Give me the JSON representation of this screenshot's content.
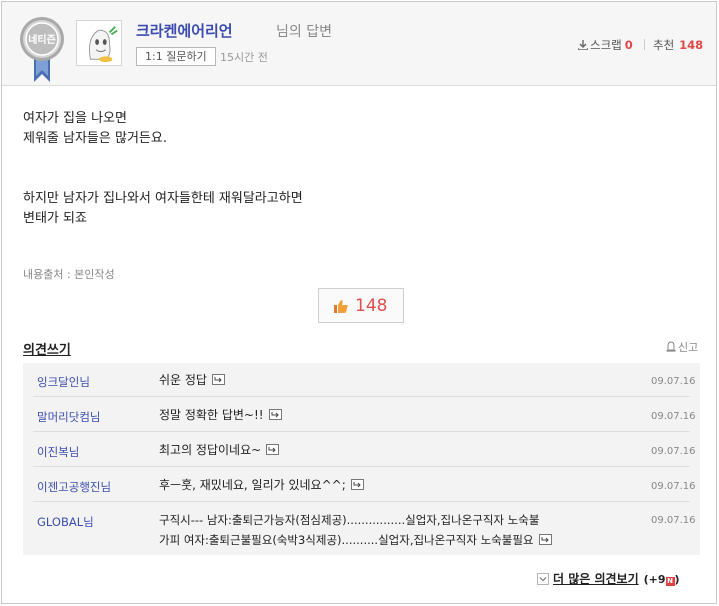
{
  "header": {
    "badge_text": "네티즌",
    "author_name": "크라켄에어리언",
    "author_suffix": "님의 답변",
    "qna_button": "1:1 질문하기",
    "time_ago": "15시간 전",
    "scrap_label": "스크랩",
    "scrap_count": "0",
    "recommend_label": "추천",
    "recommend_count": "148"
  },
  "answer": {
    "lines": [
      "여자가 집을 나오면",
      "제워줄 남자들은 많거든요.",
      "하지만 남자가 집나와서 여자들한테 재워달라고하면",
      "변태가 되죠"
    ],
    "source": "내용출처 : 본인작성"
  },
  "like_button": {
    "count": "148"
  },
  "opinion": {
    "title": "의견쓰기",
    "report": "신고",
    "comments": [
      {
        "nick": "잉크달인님",
        "text": [
          "쉬운 정답"
        ],
        "date": "09.07.16"
      },
      {
        "nick": "말머리닷컴님",
        "text": [
          "정말 정확한 답변~!!"
        ],
        "date": "09.07.16"
      },
      {
        "nick": "이진복님",
        "text": [
          "최고의 정답이네요~"
        ],
        "date": "09.07.16"
      },
      {
        "nick": "이젠고공행진님",
        "text": [
          "후ㅡ훗, 재밌네요, 일리가 있네요^^;"
        ],
        "date": "09.07.16"
      },
      {
        "nick": "GLOBAL님",
        "text": [
          "구직시--- 남자:출퇴근가능자(점심제공)................실업자,집나온구직자 노숙불",
          "가피 여자:출퇴근불필요(숙박3식제공)..........실업자,집나온구직자 노숙불필요"
        ],
        "date": "09.07.16"
      }
    ],
    "more_label": "더 많은 의견보기",
    "more_count": "(+9",
    "more_new": "N",
    "more_close": ")"
  },
  "colors": {
    "author": "#3b4bb0",
    "count": "#e34848",
    "nick": "#3c4fb0"
  }
}
